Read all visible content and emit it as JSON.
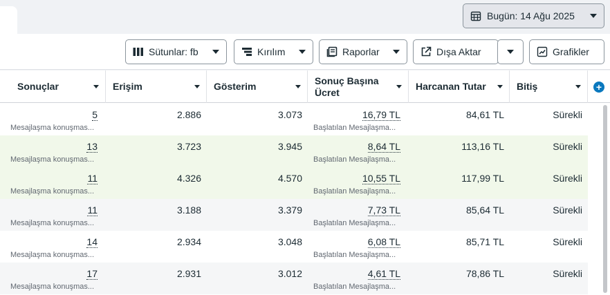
{
  "header": {
    "date_label": "Bugün: 14 Ağu 2025"
  },
  "toolbar": {
    "columns_label": "Sütunlar: fb",
    "breakdown_label": "Kırılım",
    "reports_label": "Raporlar",
    "export_label": "Dışa Aktar",
    "charts_label": "Grafikler"
  },
  "table": {
    "headers": {
      "results": "Sonuçlar",
      "reach": "Erişim",
      "impressions": "Gösterim",
      "cost_per_result_1": "Sonuç Başına",
      "cost_per_result_2": "Ücret",
      "amount_spent": "Harcanan Tutar",
      "ends": "Bitiş"
    },
    "rows": [
      {
        "results": "5",
        "results_sub": "Mesajlaşma konuşmas...",
        "reach": "2.886",
        "impressions": "3.073",
        "cpr": "16,79 TL",
        "cpr_sub": "Başlatılan Mesajlaşma...",
        "spent": "84,61 TL",
        "ends": "Sürekli"
      },
      {
        "results": "13",
        "results_sub": "Mesajlaşma konuşmas...",
        "reach": "3.723",
        "impressions": "3.945",
        "cpr": "8,64 TL",
        "cpr_sub": "Başlatılan Mesajlaşma...",
        "spent": "113,16 TL",
        "ends": "Sürekli"
      },
      {
        "results": "11",
        "results_sub": "Mesajlaşma konuşmas...",
        "reach": "4.326",
        "impressions": "4.570",
        "cpr": "10,55 TL",
        "cpr_sub": "Başlatılan Mesajlaşma...",
        "spent": "117,99 TL",
        "ends": "Sürekli"
      },
      {
        "results": "11",
        "results_sub": "Mesajlaşma konuşmas...",
        "reach": "3.188",
        "impressions": "3.379",
        "cpr": "7,73 TL",
        "cpr_sub": "Başlatılan Mesajlaşma...",
        "spent": "85,64 TL",
        "ends": "Sürekli"
      },
      {
        "results": "14",
        "results_sub": "Mesajlaşma konuşmas...",
        "reach": "2.934",
        "impressions": "3.048",
        "cpr": "6,08 TL",
        "cpr_sub": "Başlatılan Mesajlaşma...",
        "spent": "85,71 TL",
        "ends": "Sürekli"
      },
      {
        "results": "17",
        "results_sub": "Mesajlaşma konuşmas...",
        "reach": "2.931",
        "impressions": "3.012",
        "cpr": "4,61 TL",
        "cpr_sub": "Başlatılan Mesajlaşma...",
        "spent": "78,86 TL",
        "ends": "Sürekli"
      }
    ]
  },
  "icons": {
    "calendar": "calendar-icon",
    "columns": "columns-icon",
    "breakdown": "breakdown-icon",
    "reports": "reports-icon",
    "export": "export-icon",
    "charts": "chart-icon",
    "add_column": "plus-circle-icon"
  },
  "colors": {
    "accent": "#0a78be",
    "row_green": "#f1f8ea",
    "row_gray": "#f5f6f7"
  }
}
